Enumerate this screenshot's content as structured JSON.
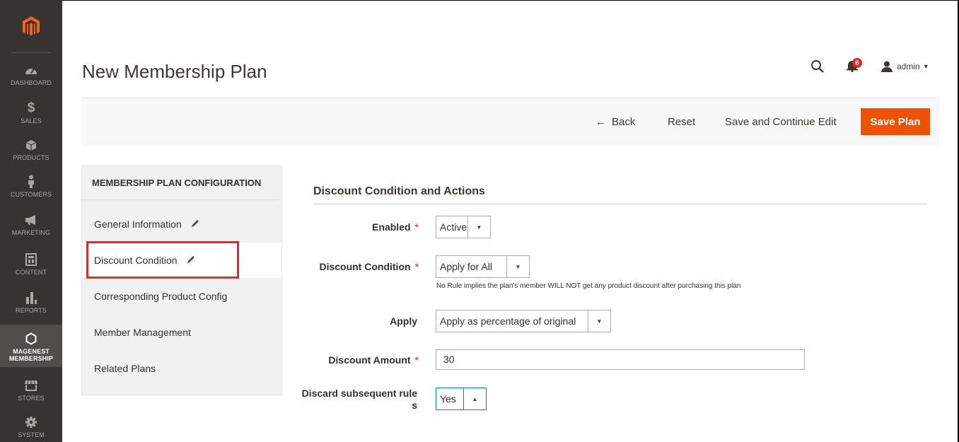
{
  "nav": {
    "items": [
      {
        "label": "DASHBOARD",
        "icon": "dashboard-icon"
      },
      {
        "label": "SALES",
        "icon": "dollar-icon"
      },
      {
        "label": "PRODUCTS",
        "icon": "box-icon"
      },
      {
        "label": "CUSTOMERS",
        "icon": "person-icon"
      },
      {
        "label": "MARKETING",
        "icon": "megaphone-icon"
      },
      {
        "label": "CONTENT",
        "icon": "layout-icon"
      },
      {
        "label": "REPORTS",
        "icon": "bar-chart-icon"
      },
      {
        "label": "MAGENEST MEMBERSHIP",
        "icon": "hexagon-icon"
      },
      {
        "label": "STORES",
        "icon": "store-icon"
      },
      {
        "label": "SYSTEM",
        "icon": "gear-icon"
      }
    ]
  },
  "header": {
    "title": "New Membership Plan",
    "notification_count": "6",
    "user_name": "admin"
  },
  "actions": {
    "back": "Back",
    "reset": "Reset",
    "save_continue": "Save and Continue Edit",
    "save": "Save Plan"
  },
  "config_menu": {
    "title": "MEMBERSHIP PLAN CONFIGURATION",
    "items": [
      {
        "label": "General Information"
      },
      {
        "label": "Discount Condition"
      },
      {
        "label": "Corresponding Product Config"
      },
      {
        "label": "Member Management"
      },
      {
        "label": "Related Plans"
      }
    ]
  },
  "form": {
    "section_title": "Discount Condition and Actions",
    "enabled": {
      "label": "Enabled",
      "value": "Active"
    },
    "discount_condition": {
      "label": "Discount Condition",
      "value": "Apply for All",
      "note": "No Rule implies the plan's member WILL NOT get any product discount after purchasing this plan"
    },
    "apply": {
      "label": "Apply",
      "value": "Apply as percentage of original"
    },
    "discount_amount": {
      "label": "Discount Amount",
      "value": "30"
    },
    "discard": {
      "label_line1": "Discard subsequent rule",
      "label_line2": "s",
      "value": "Yes"
    }
  },
  "colors": {
    "accent": "#eb5202",
    "nav_bg": "#373330",
    "highlight": "#e02b27",
    "required": "#e22626"
  }
}
